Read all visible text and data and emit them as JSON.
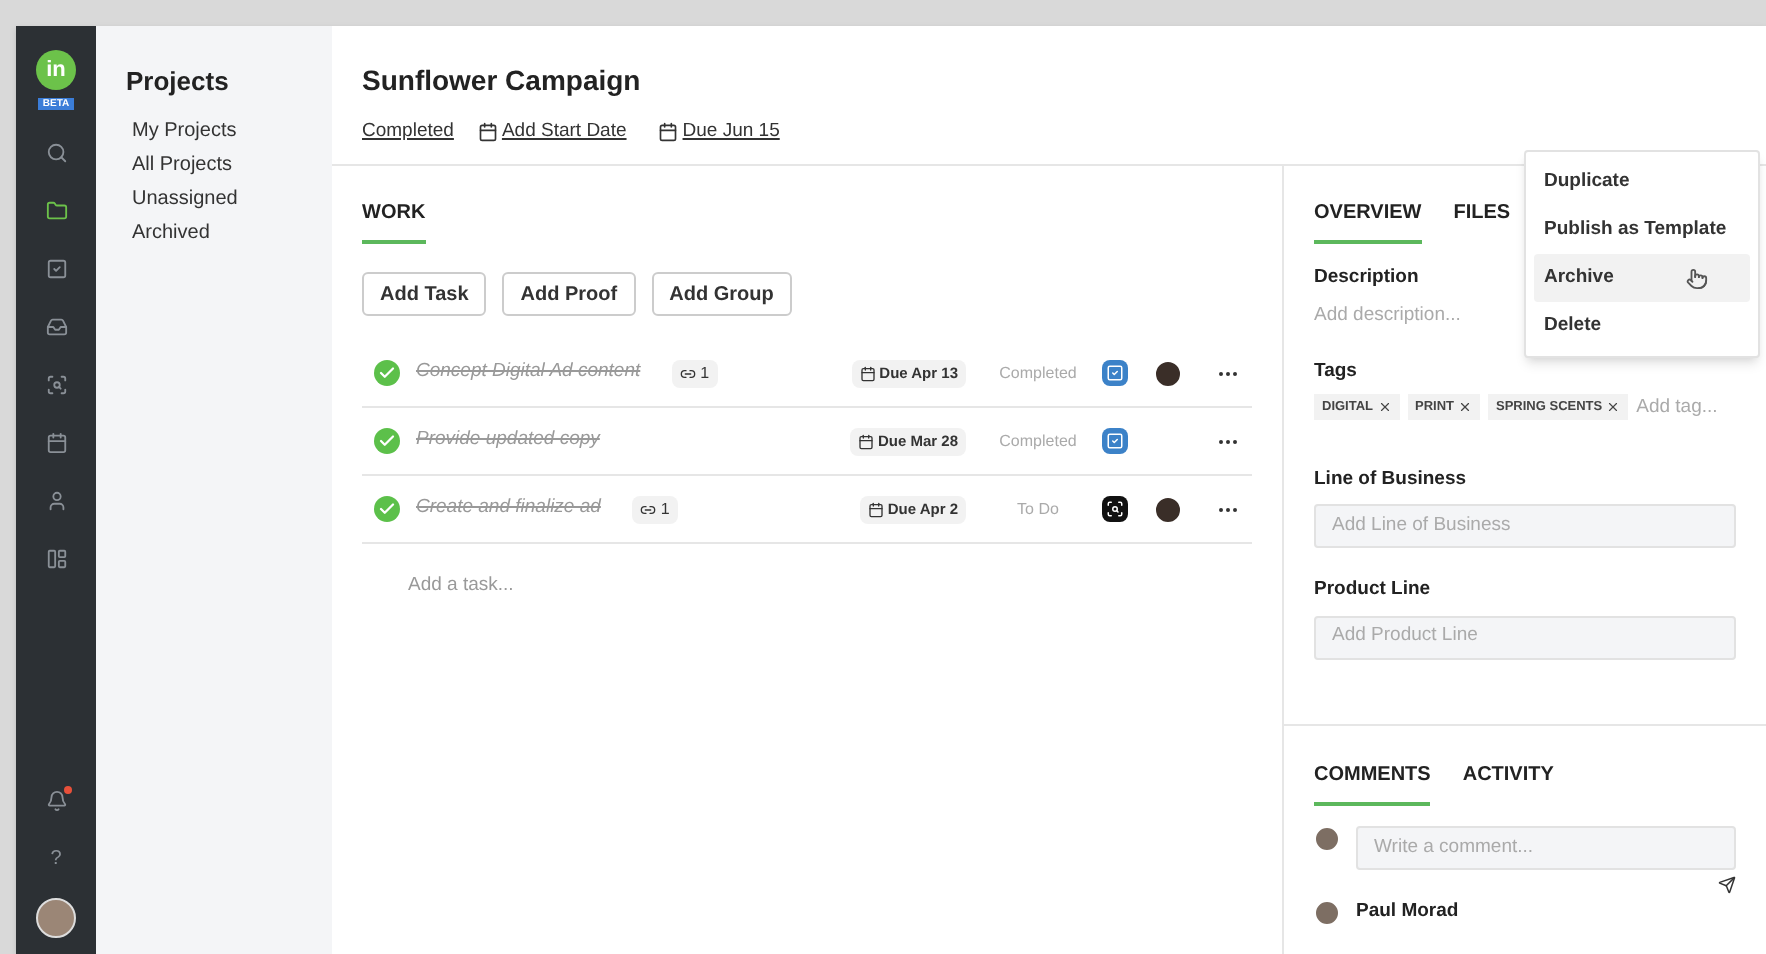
{
  "rail": {
    "logo": "in",
    "badge": "BETA",
    "items": [
      {
        "selected": false
      },
      {
        "selected": true
      },
      {
        "selected": false
      },
      {
        "selected": false
      },
      {
        "selected": false
      },
      {
        "selected": false
      },
      {
        "selected": false
      },
      {
        "selected": false
      }
    ],
    "notification_dot": true,
    "help": "?"
  },
  "sidebar": {
    "title": "Projects",
    "items": [
      "My Projects",
      "All Projects",
      "Unassigned",
      "Archived"
    ]
  },
  "header": {
    "title": "Sunflower Campaign",
    "status": "Completed",
    "start_date": "Add Start Date",
    "due": "Due Jun 15"
  },
  "work": {
    "tabs": [
      {
        "label": "WORK",
        "selected": true
      }
    ],
    "buttons": [
      "Add Task",
      "Add Proof",
      "Add Group"
    ],
    "tasks": [
      {
        "name": "Concept Digital Ad content",
        "done": true,
        "links": "1",
        "due": "Due Apr 13",
        "status": "Completed",
        "kind": "proof",
        "assignee": true
      },
      {
        "name": "Provide updated copy",
        "done": true,
        "due": "Due Mar 28",
        "status": "Completed",
        "kind": "proof",
        "assignee": false
      },
      {
        "name": "Create and finalize ad",
        "done": true,
        "links": "1",
        "due": "Due Apr 2",
        "status": "To Do",
        "kind": "review",
        "assignee": true
      }
    ],
    "add_placeholder": "Add a task..."
  },
  "panel": {
    "tabs": [
      {
        "label": "OVERVIEW",
        "selected": true
      },
      {
        "label": "FILES",
        "selected": false
      }
    ],
    "description_label": "Description",
    "description_placeholder": "Add description...",
    "tags_label": "Tags",
    "tags": [
      "DIGITAL",
      "PRINT",
      "SPRING SCENTS"
    ],
    "tag_placeholder": "Add tag...",
    "fields": [
      {
        "label": "Line of Business",
        "placeholder": "Add Line of Business"
      },
      {
        "label": "Product Line",
        "placeholder": "Add Product Line"
      }
    ],
    "comment_tabs": [
      {
        "label": "COMMENTS",
        "selected": true
      },
      {
        "label": "ACTIVITY",
        "selected": false
      }
    ],
    "comment_placeholder": "Write a comment...",
    "comments": [
      {
        "author": "Paul Morad"
      }
    ]
  },
  "menu": [
    {
      "label": "Duplicate",
      "highlighted": false
    },
    {
      "label": "Publish as Template",
      "highlighted": false
    },
    {
      "label": "Archive",
      "highlighted": true
    },
    {
      "label": "Delete",
      "highlighted": false
    }
  ]
}
